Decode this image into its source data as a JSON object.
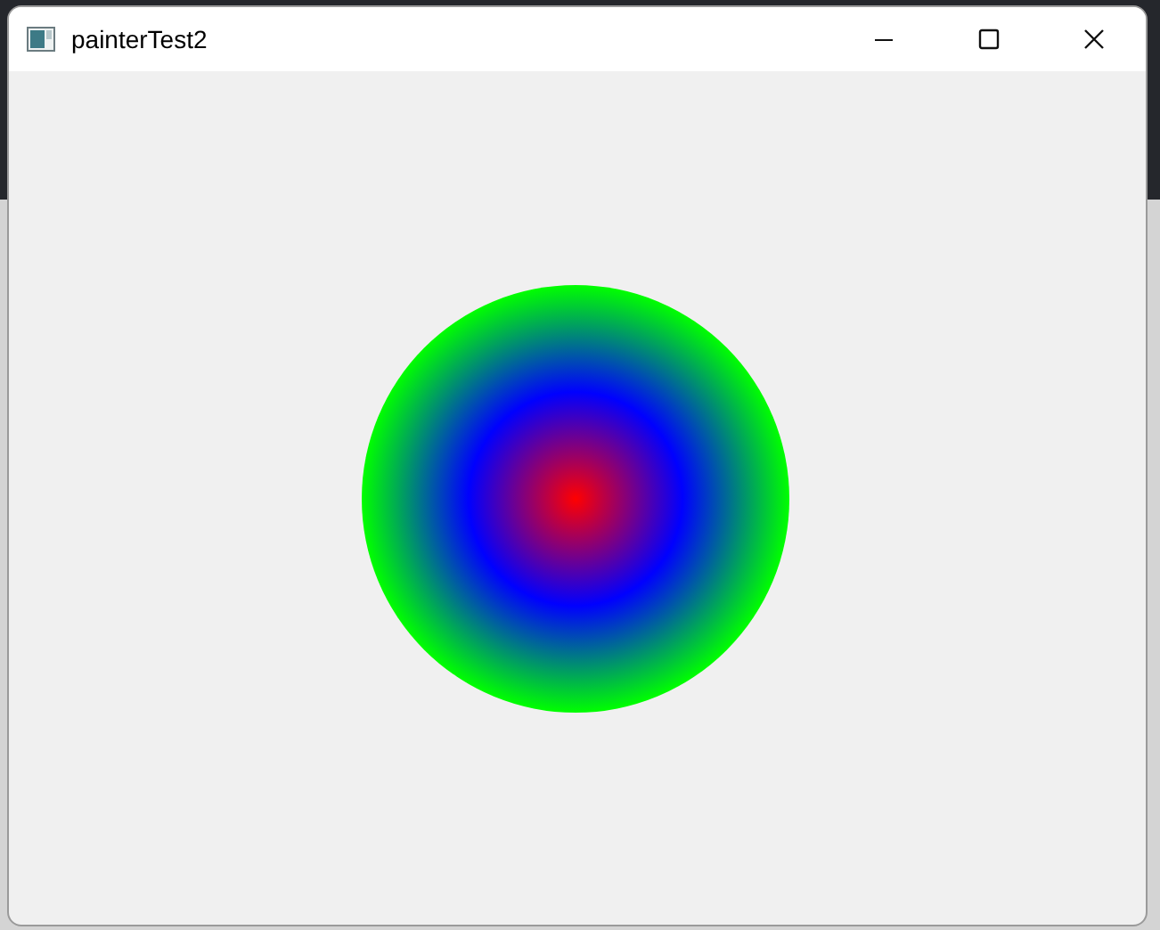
{
  "window": {
    "title": "painterTest2"
  }
}
